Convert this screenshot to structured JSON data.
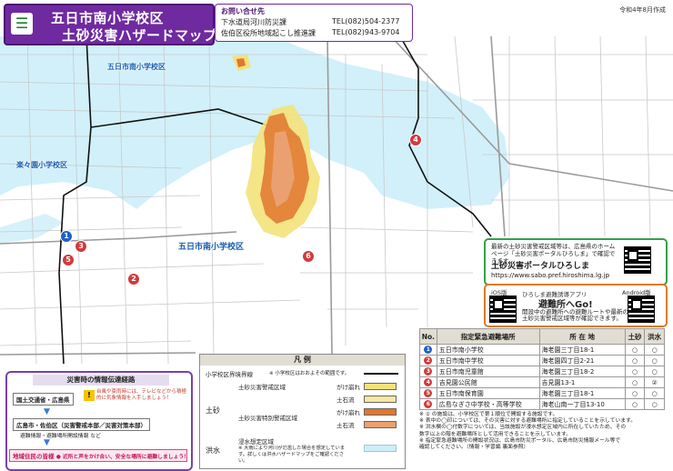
{
  "header": {
    "title_line1": "五日市南小学校区",
    "title_line2": "土砂災害ハザードマップ",
    "title_icon": "city-emblem-icon",
    "date": "令和4年8月作成"
  },
  "contact": {
    "heading": "お問い合せ先",
    "rows": [
      {
        "dept": "下水道局河川防災課",
        "tel": "TEL(082)504-2377"
      },
      {
        "dept": "佐伯区役所地域起こし推進課",
        "tel": "TEL(082)943-9704"
      }
    ]
  },
  "map_labels": {
    "school_district_top": "五日市南小学校区",
    "school_district_left": "楽々園小学校区",
    "school_district_main": "五日市南小学校区"
  },
  "markers": [
    {
      "n": "1",
      "color": "#1e62c8"
    },
    {
      "n": "2",
      "color": "#d23b3b"
    },
    {
      "n": "3",
      "color": "#d23b3b"
    },
    {
      "n": "4",
      "color": "#d23b3b"
    },
    {
      "n": "5",
      "color": "#d23b3b"
    },
    {
      "n": "6",
      "color": "#d23b3b"
    }
  ],
  "portal": {
    "text": "最新の土砂災害警戒区域等は、広島県のホームページ「土砂災害ポータルひろしま」で確認できます。",
    "name": "土砂災害ポータルひろしま",
    "url": "https://www.sabo.pref.hiroshima.lg.jp"
  },
  "app": {
    "ios": "iOS版",
    "sub": "ひろしま避難誘導アプリ",
    "name": "避難所へGo!",
    "desc": "開設中の避難所への避難ルートや最新の土砂災害警戒区域等が確認できます。",
    "android": "Android版"
  },
  "legend": {
    "title": "凡 例",
    "boundary_label": "小学校区界境界線",
    "boundary_note": "※ 小学校区はおおよその範囲です。",
    "group_dosha": "土砂",
    "warning_area": "土砂災害警戒区域",
    "special_area": "土砂災害特別警戒区域",
    "cliff": "がけ崩れ",
    "debris": "土石流",
    "flood_group": "洪水",
    "flood_area": "浸水想定区域",
    "flood_note": "※ 大雨により河川が氾濫した場合を想定しています。詳しくは洪水ハザードマップをご確認ください。",
    "colors": {
      "warning_cliff": "#f3e27a",
      "warning_debris": "#f6e8a2",
      "special_cliff": "#e0762f",
      "special_debris": "#eaa070",
      "flood": "#cfeefa"
    }
  },
  "communication": {
    "heading": "災害時の情報伝達経路",
    "box1": "国土交通省・広島県",
    "warn": "台風や豪雨時には、テレビなどから積極的に気象情報を入手しましょう！",
    "box2": "広島市・佐伯区（災害警戒本部／災害対策本部）",
    "box2_sub": "避難情報・避難場所開設情報 など",
    "box3": "地域住民の皆様",
    "box3_sub": "● 近所と声をかけ合い、安全な場所に避難しましょう！"
  },
  "shelters": {
    "headers": [
      "No.",
      "指定緊急避難場所",
      "所 在 地",
      "土砂",
      "洪水"
    ],
    "rows": [
      {
        "n": "1",
        "name": "五日市南小学校",
        "addr": "海老園三丁目18-1",
        "dosha": "○",
        "flood": "○"
      },
      {
        "n": "2",
        "name": "五日市南中学校",
        "addr": "海老園四丁目2-21",
        "dosha": "○",
        "flood": "○"
      },
      {
        "n": "3",
        "name": "五日市南児童館",
        "addr": "海老園三丁目18-2",
        "dosha": "○",
        "flood": "○"
      },
      {
        "n": "4",
        "name": "吉見園公民館",
        "addr": "吉見園13-1",
        "dosha": "○",
        "flood": "②"
      },
      {
        "n": "5",
        "name": "五日市南保育園",
        "addr": "海老園三丁目18-1",
        "dosha": "○",
        "flood": "○"
      },
      {
        "n": "6",
        "name": "広島なぎさ中学校・高等学校",
        "addr": "海老山南一丁目13-10",
        "dosha": "○",
        "flood": "○"
      }
    ],
    "notes": [
      "※ ① の施設は、小学校区で第１順位で開設する施設です。",
      "※ 表中の◯印については、その災害に対する避難場所に指定していることを示しています。",
      "※ 洪水欄の◯付数字については、当該施設が浸水想定区域内に所在していたため、その",
      "数字以上の階を避難場所として活用できることを示しています。",
      "※ 指定緊急避難場所の開設状況は、広島市防災ポータル、広島市防災情報メール等で",
      "確認してください。（情報・学習編 裏面参照）"
    ]
  }
}
